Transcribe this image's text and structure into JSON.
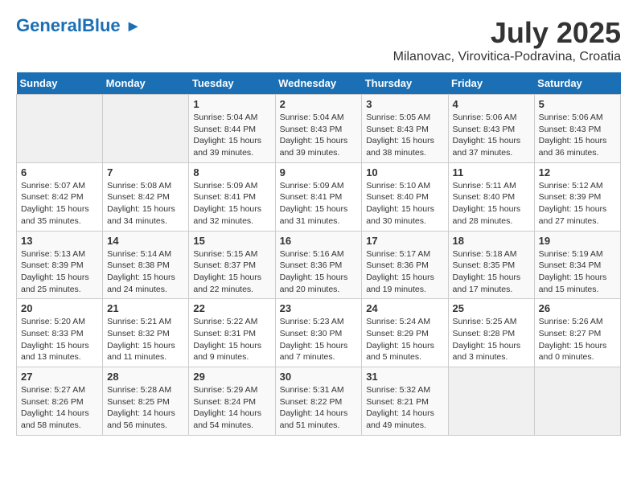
{
  "header": {
    "logo_line1": "General",
    "logo_line2": "Blue",
    "title": "July 2025",
    "subtitle": "Milanovac, Virovitica-Podravina, Croatia"
  },
  "days_of_week": [
    "Sunday",
    "Monday",
    "Tuesday",
    "Wednesday",
    "Thursday",
    "Friday",
    "Saturday"
  ],
  "weeks": [
    [
      {
        "day": "",
        "info": ""
      },
      {
        "day": "",
        "info": ""
      },
      {
        "day": "1",
        "info": "Sunrise: 5:04 AM\nSunset: 8:44 PM\nDaylight: 15 hours and 39 minutes."
      },
      {
        "day": "2",
        "info": "Sunrise: 5:04 AM\nSunset: 8:43 PM\nDaylight: 15 hours and 39 minutes."
      },
      {
        "day": "3",
        "info": "Sunrise: 5:05 AM\nSunset: 8:43 PM\nDaylight: 15 hours and 38 minutes."
      },
      {
        "day": "4",
        "info": "Sunrise: 5:06 AM\nSunset: 8:43 PM\nDaylight: 15 hours and 37 minutes."
      },
      {
        "day": "5",
        "info": "Sunrise: 5:06 AM\nSunset: 8:43 PM\nDaylight: 15 hours and 36 minutes."
      }
    ],
    [
      {
        "day": "6",
        "info": "Sunrise: 5:07 AM\nSunset: 8:42 PM\nDaylight: 15 hours and 35 minutes."
      },
      {
        "day": "7",
        "info": "Sunrise: 5:08 AM\nSunset: 8:42 PM\nDaylight: 15 hours and 34 minutes."
      },
      {
        "day": "8",
        "info": "Sunrise: 5:09 AM\nSunset: 8:41 PM\nDaylight: 15 hours and 32 minutes."
      },
      {
        "day": "9",
        "info": "Sunrise: 5:09 AM\nSunset: 8:41 PM\nDaylight: 15 hours and 31 minutes."
      },
      {
        "day": "10",
        "info": "Sunrise: 5:10 AM\nSunset: 8:40 PM\nDaylight: 15 hours and 30 minutes."
      },
      {
        "day": "11",
        "info": "Sunrise: 5:11 AM\nSunset: 8:40 PM\nDaylight: 15 hours and 28 minutes."
      },
      {
        "day": "12",
        "info": "Sunrise: 5:12 AM\nSunset: 8:39 PM\nDaylight: 15 hours and 27 minutes."
      }
    ],
    [
      {
        "day": "13",
        "info": "Sunrise: 5:13 AM\nSunset: 8:39 PM\nDaylight: 15 hours and 25 minutes."
      },
      {
        "day": "14",
        "info": "Sunrise: 5:14 AM\nSunset: 8:38 PM\nDaylight: 15 hours and 24 minutes."
      },
      {
        "day": "15",
        "info": "Sunrise: 5:15 AM\nSunset: 8:37 PM\nDaylight: 15 hours and 22 minutes."
      },
      {
        "day": "16",
        "info": "Sunrise: 5:16 AM\nSunset: 8:36 PM\nDaylight: 15 hours and 20 minutes."
      },
      {
        "day": "17",
        "info": "Sunrise: 5:17 AM\nSunset: 8:36 PM\nDaylight: 15 hours and 19 minutes."
      },
      {
        "day": "18",
        "info": "Sunrise: 5:18 AM\nSunset: 8:35 PM\nDaylight: 15 hours and 17 minutes."
      },
      {
        "day": "19",
        "info": "Sunrise: 5:19 AM\nSunset: 8:34 PM\nDaylight: 15 hours and 15 minutes."
      }
    ],
    [
      {
        "day": "20",
        "info": "Sunrise: 5:20 AM\nSunset: 8:33 PM\nDaylight: 15 hours and 13 minutes."
      },
      {
        "day": "21",
        "info": "Sunrise: 5:21 AM\nSunset: 8:32 PM\nDaylight: 15 hours and 11 minutes."
      },
      {
        "day": "22",
        "info": "Sunrise: 5:22 AM\nSunset: 8:31 PM\nDaylight: 15 hours and 9 minutes."
      },
      {
        "day": "23",
        "info": "Sunrise: 5:23 AM\nSunset: 8:30 PM\nDaylight: 15 hours and 7 minutes."
      },
      {
        "day": "24",
        "info": "Sunrise: 5:24 AM\nSunset: 8:29 PM\nDaylight: 15 hours and 5 minutes."
      },
      {
        "day": "25",
        "info": "Sunrise: 5:25 AM\nSunset: 8:28 PM\nDaylight: 15 hours and 3 minutes."
      },
      {
        "day": "26",
        "info": "Sunrise: 5:26 AM\nSunset: 8:27 PM\nDaylight: 15 hours and 0 minutes."
      }
    ],
    [
      {
        "day": "27",
        "info": "Sunrise: 5:27 AM\nSunset: 8:26 PM\nDaylight: 14 hours and 58 minutes."
      },
      {
        "day": "28",
        "info": "Sunrise: 5:28 AM\nSunset: 8:25 PM\nDaylight: 14 hours and 56 minutes."
      },
      {
        "day": "29",
        "info": "Sunrise: 5:29 AM\nSunset: 8:24 PM\nDaylight: 14 hours and 54 minutes."
      },
      {
        "day": "30",
        "info": "Sunrise: 5:31 AM\nSunset: 8:22 PM\nDaylight: 14 hours and 51 minutes."
      },
      {
        "day": "31",
        "info": "Sunrise: 5:32 AM\nSunset: 8:21 PM\nDaylight: 14 hours and 49 minutes."
      },
      {
        "day": "",
        "info": ""
      },
      {
        "day": "",
        "info": ""
      }
    ]
  ]
}
